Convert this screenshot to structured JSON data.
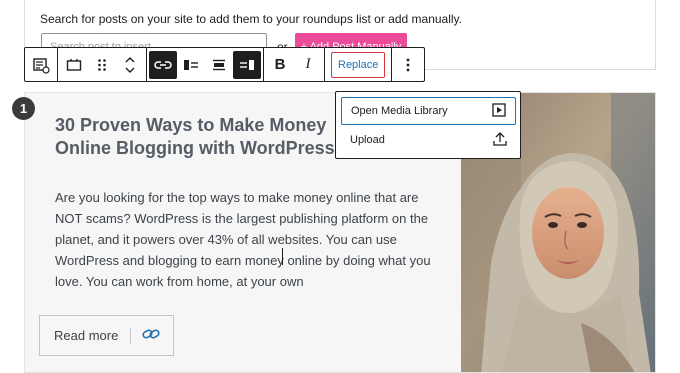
{
  "search_block": {
    "description": "Search for posts on your site to add them to your roundups list or add manually.",
    "search_placeholder": "Search post to insert",
    "or_label": "or",
    "add_post_label": "+ Add Post Manually",
    "accent_color": "#ec4a9b"
  },
  "toolbar": {
    "groups": [
      [
        "block-type-icon"
      ],
      [
        "card-layout-icon",
        "drag-handle-icon",
        "move-up-down-icon"
      ],
      [
        "link-icon",
        "align-left-media-icon",
        "align-center-icon",
        "align-right-media-icon"
      ],
      [
        "bold-icon",
        "italic-icon"
      ],
      [
        "replace-button"
      ],
      [
        "more-options-icon"
      ]
    ],
    "bold_label": "B",
    "italic_label": "I",
    "replace_label": "Replace"
  },
  "card": {
    "badge_number": "1",
    "title": "30 Proven Ways to Make Money Online Blogging with WordPress",
    "excerpt": "Are you looking for the top ways to make money online that are NOT scams? WordPress is the largest publishing platform on the planet, and it powers over 43% of all websites. You can use WordPress and blogging to earn money online by doing what you love. You can work from home, at your own",
    "read_more_label": "Read more",
    "image_alt": "woman-in-hijab-photo"
  },
  "replace_menu": {
    "items": [
      {
        "label": "Open Media Library",
        "icon": "media-library-icon"
      },
      {
        "label": "Upload",
        "icon": "upload-icon"
      }
    ]
  }
}
